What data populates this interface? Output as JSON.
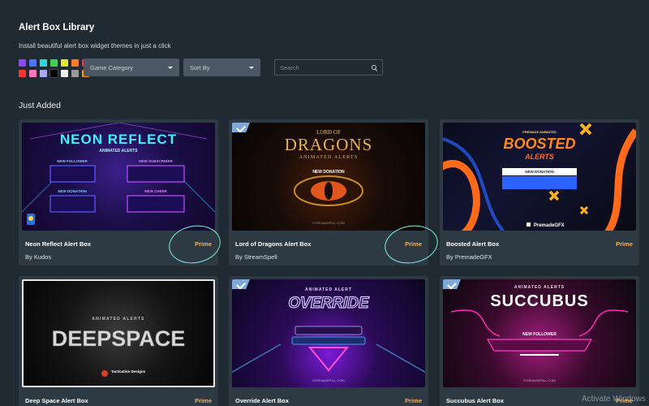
{
  "header": {
    "title": "Alert Box Library",
    "subtitle": "Install beautiful alert box widget themes in just a click"
  },
  "palette": [
    "#8b45ff",
    "#4f72ff",
    "#2ad9d9",
    "#3fd04d",
    "#e6e62a",
    "#ff7a2a",
    "#ff2a5b",
    "#ff3333",
    "#ff7ab6",
    "#a7a7ff",
    "#000000",
    "#f0f0f0",
    "#9a9a9a",
    "#ff9900"
  ],
  "filters": {
    "category": "Game Category",
    "sort": "Sort By",
    "search_placeholder": "Search"
  },
  "section_title": "Just Added",
  "cards": [
    {
      "title": "Neon Reflect Alert Box",
      "price": "Prime",
      "author": "By Kudos",
      "theme": "neon",
      "prime_badge": false
    },
    {
      "title": "Lord of Dragons Alert Box",
      "price": "Prime",
      "author": "By StreamSpell",
      "theme": "dragons",
      "prime_badge": true
    },
    {
      "title": "Boosted Alert Box",
      "price": "Prime",
      "author": "By PremadeGFX",
      "theme": "boosted",
      "prime_badge": false
    },
    {
      "title": "Deep Space Alert Box",
      "price": "Prime",
      "author": "",
      "theme": "deep",
      "prime_badge": false
    },
    {
      "title": "Override Alert Box",
      "price": "Prime",
      "author": "",
      "theme": "override",
      "prime_badge": true
    },
    {
      "title": "Succubus Alert Box",
      "price": "Prime",
      "author": "",
      "theme": "succubus",
      "prime_badge": true
    }
  ],
  "thumb_text": {
    "neon": {
      "title": "NEON REFLECT",
      "sub": "ANIMATED ALERTS",
      "l1": "NEW FOLLOWER",
      "l2": "NEW SUBSCRIBER",
      "l3": "NEW DONATION",
      "l4": "NEW CHEER"
    },
    "dragons": {
      "top": "LORD OF",
      "title": "DRAGONS",
      "sub": "ANIMATED ALERTS",
      "label": "NEW DONATION",
      "footer": "STREAMSPELL.COM"
    },
    "boosted": {
      "small": "PREMADE ANIMATED",
      "title": "BOOSTED",
      "sub": "ALERTS",
      "label": "NEW DONATION",
      "brand": "PremadeGFX"
    },
    "deep": {
      "sub": "ANIMATED ALERTS",
      "title": "DEEPSPACE",
      "brand": "Tactication Designs"
    },
    "override": {
      "sub": "ANIMATED ALERT",
      "title": "OVERRIDE",
      "footer": "STREAMSPELL.COM"
    },
    "succubus": {
      "sub": "ANIMATED ALERTS",
      "title": "SUCCUBUS",
      "label": "NEW FOLLOWER",
      "footer": "STREAMSPELL.COM"
    }
  },
  "watermark": "Activate Windows",
  "colors": {
    "background": "#1f2a33",
    "card": "#2d3a44",
    "price": "#f2b35d",
    "annotation": "#7ff0df"
  }
}
